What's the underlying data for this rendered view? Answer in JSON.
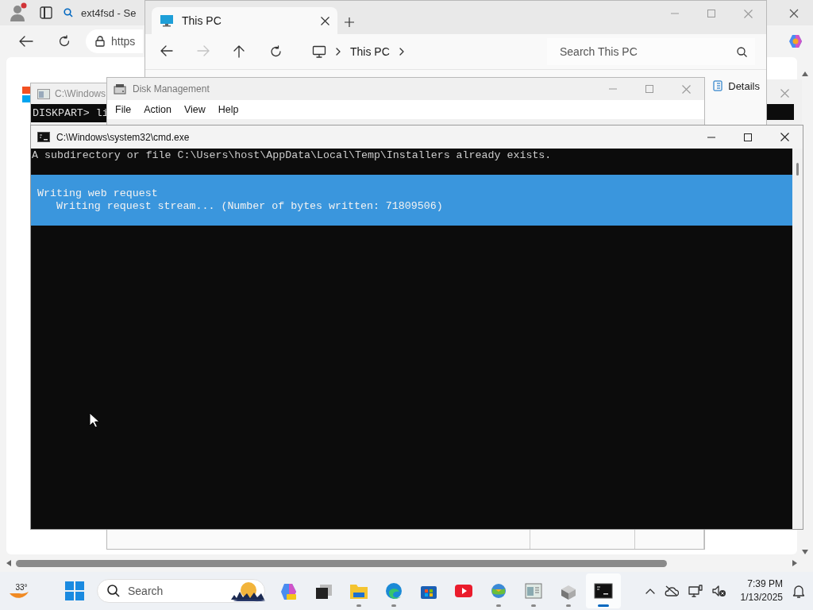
{
  "browser": {
    "tab_title": "ext4fsd - Se",
    "address": "https"
  },
  "background_console": {
    "title": "C:\\Windows",
    "line": "DISKPART> li"
  },
  "explorer": {
    "tab_title": "This PC",
    "nav_buttons": [
      {
        "kind": "back",
        "disabled": false
      },
      {
        "kind": "forward",
        "disabled": true
      },
      {
        "kind": "up",
        "disabled": false
      },
      {
        "kind": "refresh",
        "disabled": false
      }
    ],
    "breadcrumb": [
      "This PC"
    ],
    "search": {
      "placeholder": "Search This PC"
    },
    "details_button": "Details"
  },
  "disk_management": {
    "title": "Disk Management",
    "menu": [
      "File",
      "Action",
      "View",
      "Help"
    ]
  },
  "cmd": {
    "title": "C:\\Windows\\system32\\cmd.exe",
    "lines": [
      "A subdirectory or file C:\\Users\\host\\AppData\\Local\\Temp\\Installers already exists."
    ],
    "progress": {
      "heading": "Writing web request",
      "detail": "   Writing request stream... (Number of bytes written: 71809506)"
    }
  },
  "taskbar": {
    "weather": "33°",
    "search": {
      "placeholder": "Search"
    },
    "apps": [
      {
        "kind": "copilot",
        "running": false,
        "selected": false
      },
      {
        "kind": "taskview",
        "running": false,
        "selected": false
      },
      {
        "kind": "folder",
        "running": true,
        "selected": false
      },
      {
        "kind": "edge",
        "running": true,
        "selected": false
      },
      {
        "kind": "store",
        "running": false,
        "selected": false
      },
      {
        "kind": "youtube",
        "running": false,
        "selected": false
      },
      {
        "kind": "globe",
        "running": true,
        "selected": false
      },
      {
        "kind": "diskmgmt",
        "running": true,
        "selected": false
      },
      {
        "kind": "tool",
        "running": true,
        "selected": false
      },
      {
        "kind": "terminal",
        "running": true,
        "selected": true
      }
    ],
    "time": "7:39 PM",
    "date": "1/13/2025"
  }
}
